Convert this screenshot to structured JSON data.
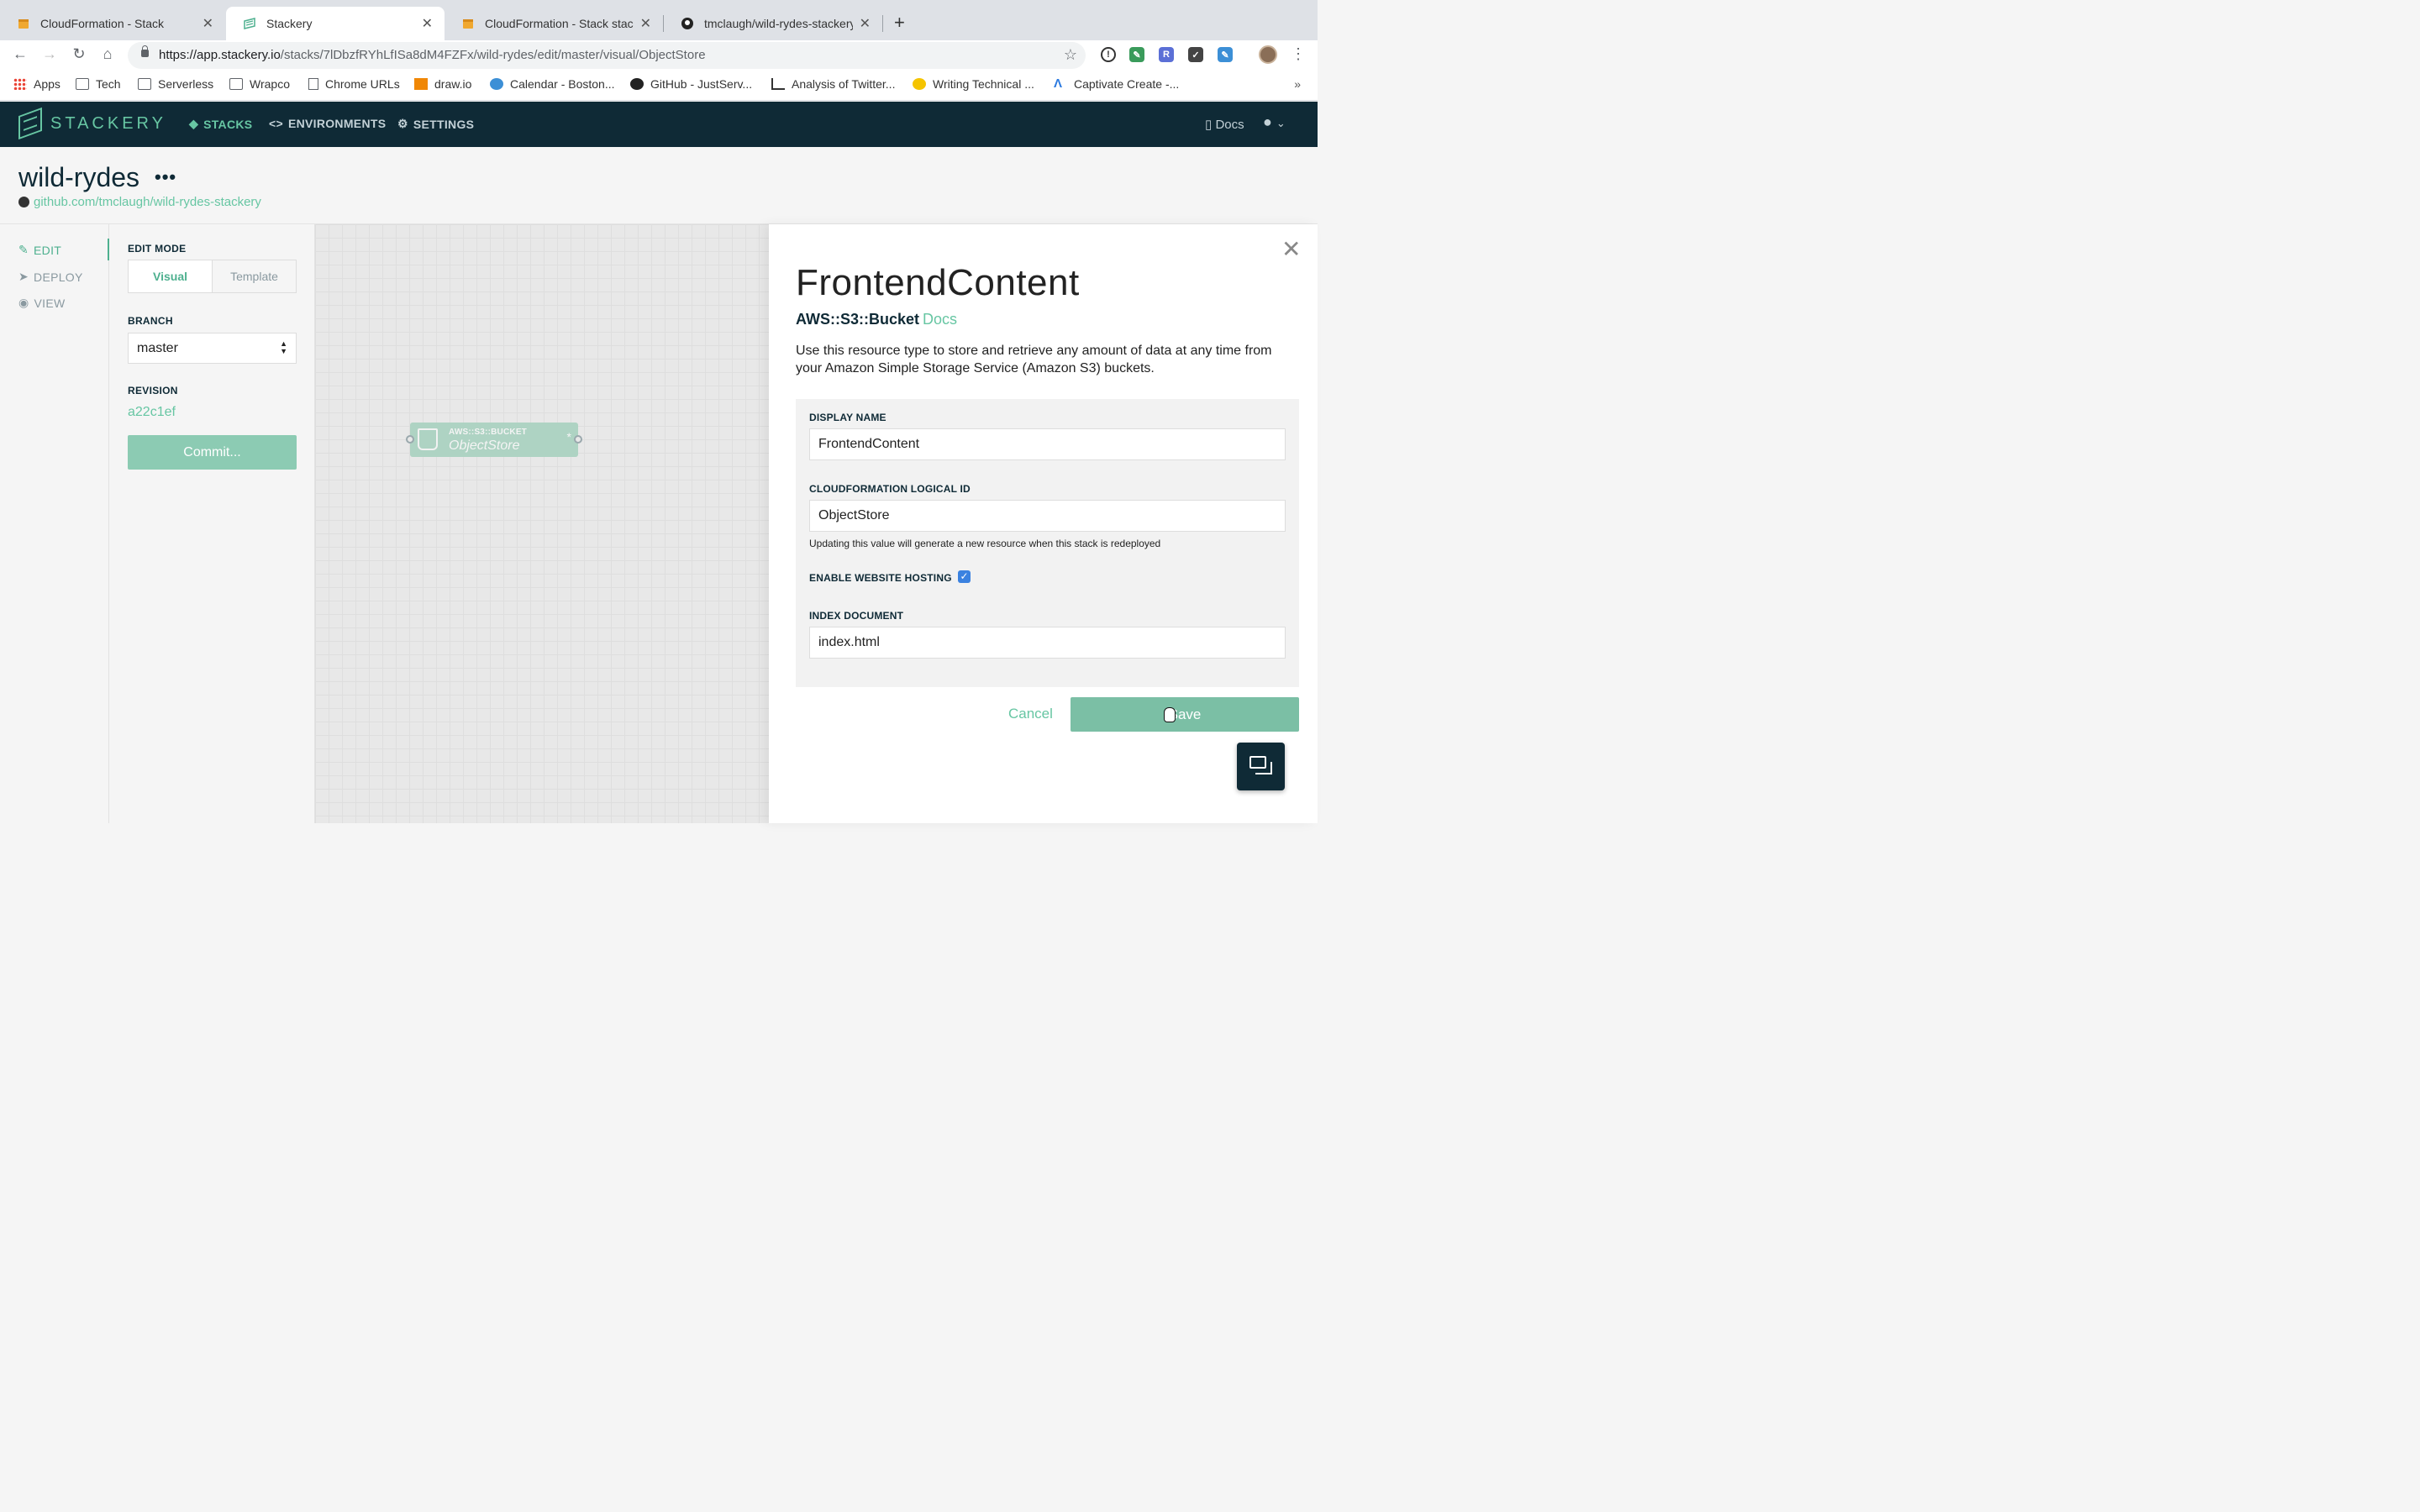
{
  "browser": {
    "tabs": [
      {
        "title": "CloudFormation - Stack",
        "favicon": "aws-box-icon",
        "active": false
      },
      {
        "title": "Stackery",
        "favicon": "stackery-logo-icon",
        "active": true
      },
      {
        "title": "CloudFormation - Stack stacke",
        "favicon": "aws-box-icon",
        "active": false
      },
      {
        "title": "tmclaugh/wild-rydes-stackery",
        "favicon": "github-icon",
        "active": false
      }
    ],
    "url_host": "https://app.stackery.io",
    "url_path": "/stacks/7lDbzfRYhLfISa8dM4FZFx/wild-rydes/edit/master/visual/ObjectStore",
    "bookmarks": [
      "Apps",
      "Tech",
      "Serverless",
      "Wrapco",
      "Chrome URLs",
      "draw.io",
      "Calendar - Boston...",
      "GitHub - JustServ...",
      "Analysis of Twitter...",
      "Writing Technical ...",
      "Captivate Create -..."
    ],
    "more": "»"
  },
  "app": {
    "logo_text": "STACKERY",
    "nav": {
      "stacks": "STACKS",
      "environments": "ENVIRONMENTS",
      "settings": "SETTINGS"
    },
    "docs": "Docs"
  },
  "stack": {
    "name": "wild-rydes",
    "more": "•••",
    "repo": "github.com/tmclaugh/wild-rydes-stackery"
  },
  "leftnav": {
    "edit": "EDIT",
    "deploy": "DEPLOY",
    "view": "VIEW"
  },
  "editpanel": {
    "edit_mode_label": "EDIT MODE",
    "mode_visual": "Visual",
    "mode_template": "Template",
    "branch_label": "BRANCH",
    "branch_value": "master",
    "revision_label": "REVISION",
    "revision_value": "a22c1ef",
    "commit": "Commit..."
  },
  "canvas": {
    "node_type": "AWS::S3::BUCKET",
    "node_name": "ObjectStore",
    "node_marker": "*"
  },
  "drawer": {
    "title": "FrontendContent",
    "resource_type": "AWS::S3::Bucket",
    "docs": "Docs",
    "description": "Use this resource type to store and retrieve any amount of data at any time from your Amazon Simple Storage Service (Amazon S3) buckets.",
    "display_name_label": "DISPLAY NAME",
    "display_name_value": "FrontendContent",
    "logical_id_label": "CLOUDFORMATION LOGICAL ID",
    "logical_id_value": "ObjectStore",
    "logical_id_hint": "Updating this value will generate a new resource when this stack is redeployed",
    "website_hosting_label": "ENABLE WEBSITE HOSTING",
    "website_hosting_checked": true,
    "index_doc_label": "INDEX DOCUMENT",
    "index_doc_value": "index.html",
    "cancel": "Cancel",
    "save": "Save"
  },
  "colors": {
    "accent": "#67c6a3",
    "header": "#0f2a36",
    "checkbox": "#3b82e0"
  }
}
